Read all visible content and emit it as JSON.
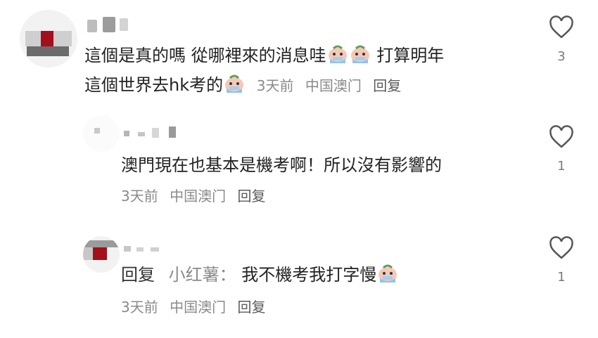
{
  "comment": {
    "text_line1": "這個是真的嗎 從哪裡來的消息哇",
    "text_line1_end": "打算明年",
    "text_line2": "這個世界去hk考的",
    "time": "3天前",
    "location": "中国澳门",
    "reply_label": "回复",
    "likes": "3"
  },
  "replies": [
    {
      "text": "澳門現在也基本是機考啊！所以沒有影響的",
      "time": "3天前",
      "location": "中国澳门",
      "reply_label": "回复",
      "likes": "1"
    },
    {
      "prefix": "回复",
      "reply_to": "小红薯：",
      "text": "我不機考我打字慢",
      "time": "3天前",
      "location": "中国澳门",
      "reply_label": "回复",
      "likes": "1"
    }
  ],
  "icons": {
    "heart": "heart-outline-icon",
    "emoji": "crying-emoji-icon"
  },
  "colors": {
    "text": "#222222",
    "meta": "#8a8a8a",
    "heart_stroke": "#555555"
  }
}
